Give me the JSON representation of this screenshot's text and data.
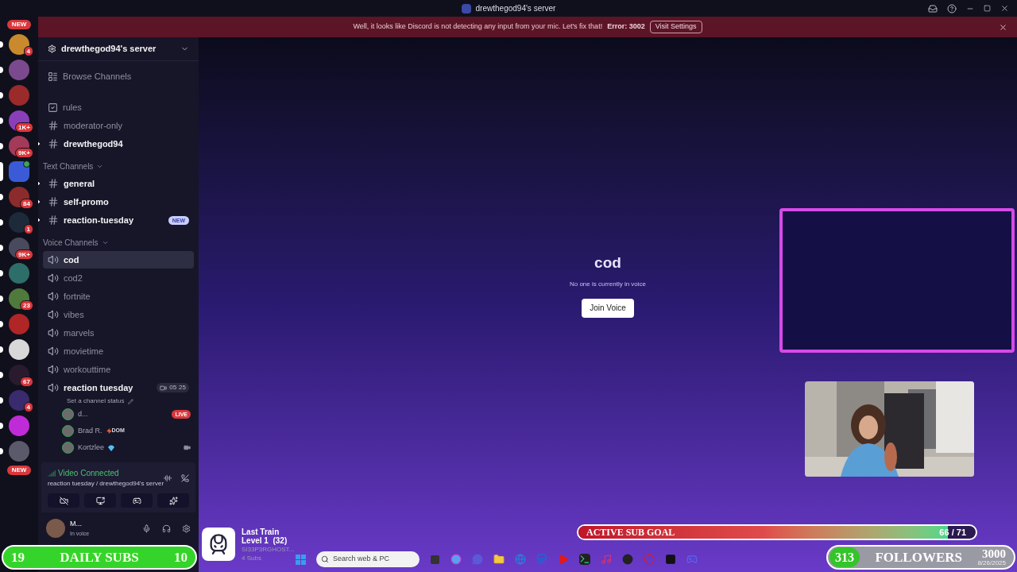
{
  "window": {
    "title": "drewthegod94's server"
  },
  "notice": {
    "message": "Well, it looks like Discord is not detecting any input from your mic. Let's fix that!",
    "error": "Error: 3002",
    "action": "Visit Settings"
  },
  "server_rail": {
    "top_pill": "NEW",
    "bottom_pill": "NEW"
  },
  "servers": [
    {
      "badge": "4",
      "color": "#c98a2e",
      "unread": true,
      "selected": false
    },
    {
      "color": "#7b4a8e",
      "unread": true,
      "selected": false
    },
    {
      "color": "#9b2a2a",
      "unread": true,
      "selected": false
    },
    {
      "badge": "1K+",
      "color": "#8a3fb8",
      "unread": true,
      "selected": false
    },
    {
      "badge": "9K+",
      "color": "#a33a5a",
      "unread": true,
      "selected": false
    },
    {
      "color": "#3b5bd6",
      "selected": true
    },
    {
      "badge": "84",
      "color": "#8c2b2b",
      "unread": true,
      "selected": false
    },
    {
      "badge": "1",
      "color": "#1c2a3a",
      "unread": true,
      "selected": false
    },
    {
      "badge": "9K+",
      "color": "#4a4a5e",
      "unread": true,
      "selected": false
    },
    {
      "color": "#2e6e6a",
      "unread": true,
      "selected": false
    },
    {
      "badge": "23",
      "color": "#4f7a3c",
      "unread": true,
      "selected": false
    },
    {
      "color": "#b02525",
      "unread": true,
      "selected": false
    },
    {
      "color": "#d8d8d8",
      "unread": true,
      "selected": false
    },
    {
      "badge": "67",
      "color": "#2a1a2e",
      "unread": true,
      "selected": false
    },
    {
      "badge": "4",
      "color": "#3a2a6e",
      "unread": true,
      "selected": false
    },
    {
      "color": "#c02bd8",
      "unread": true,
      "selected": false
    },
    {
      "color": "#5a5a6a",
      "unread": true,
      "selected": false
    }
  ],
  "server_header": {
    "name": "drewthegod94's server"
  },
  "channels": [
    {
      "kind": "browse",
      "name": "Browse Channels",
      "unread": false
    },
    {
      "kind": "rules",
      "name": "rules",
      "unread": false
    },
    {
      "kind": "private",
      "name": "moderator-only",
      "unread": false
    },
    {
      "kind": "text",
      "name": "drewthegod94",
      "unread": true
    },
    {
      "kind": "category",
      "name": "Text Channels"
    },
    {
      "kind": "text",
      "name": "general",
      "unread": true
    },
    {
      "kind": "text",
      "name": "self-promo",
      "unread": true
    },
    {
      "kind": "text",
      "name": "reaction-tuesday",
      "unread": true,
      "badge": "NEW"
    },
    {
      "kind": "category",
      "name": "Voice Channels"
    },
    {
      "kind": "voice",
      "name": "cod",
      "unread": true,
      "selected": true
    },
    {
      "kind": "voice",
      "name": "cod2",
      "unread": false,
      "selected": false
    },
    {
      "kind": "voice",
      "name": "fortnite",
      "unread": false,
      "selected": false
    },
    {
      "kind": "voice",
      "name": "vibes",
      "unread": false,
      "selected": false
    },
    {
      "kind": "voice",
      "name": "marvels",
      "unread": false,
      "selected": false
    },
    {
      "kind": "voice",
      "name": "movietime",
      "unread": false,
      "selected": false
    },
    {
      "kind": "voice",
      "name": "workouttime",
      "unread": false,
      "selected": false
    },
    {
      "kind": "voice",
      "name": "reaction tuesday",
      "unread": true,
      "selected": false,
      "counts": [
        "05",
        "25"
      ],
      "status": "Set a channel status",
      "members": [
        {
          "name": "d...",
          "badge": "LIVE"
        },
        {
          "name": "Brad R.",
          "tag": "DOM"
        },
        {
          "name": "Kortzlee",
          "video": true,
          "gem": true
        }
      ]
    }
  ],
  "voice_panel": {
    "state": "Video Connected",
    "location": "reaction tuesday / drewthegod94's server"
  },
  "user": {
    "name": "M...",
    "status": "In voice"
  },
  "main": {
    "channel": "cod",
    "message": "No one is currently in voice",
    "button": "Join Voice"
  },
  "overlay": {
    "daily_subs": {
      "current": "19",
      "label": "DAILY SUBS",
      "target": "10"
    },
    "last_train": {
      "title": "Last Train",
      "level": "Level 1  (32)",
      "user": "SI33P3RGHOST...",
      "subs": "4 Subs"
    },
    "taskbar": {
      "search": "Search web & PC"
    },
    "sub_goal": {
      "label": "ACTIVE SUB GOAL",
      "reading": "66 / 71",
      "level": 0.93
    },
    "followers": {
      "current": "313",
      "label": "FOLLOWERS",
      "target": "3000",
      "date": "8/26/2025"
    }
  }
}
